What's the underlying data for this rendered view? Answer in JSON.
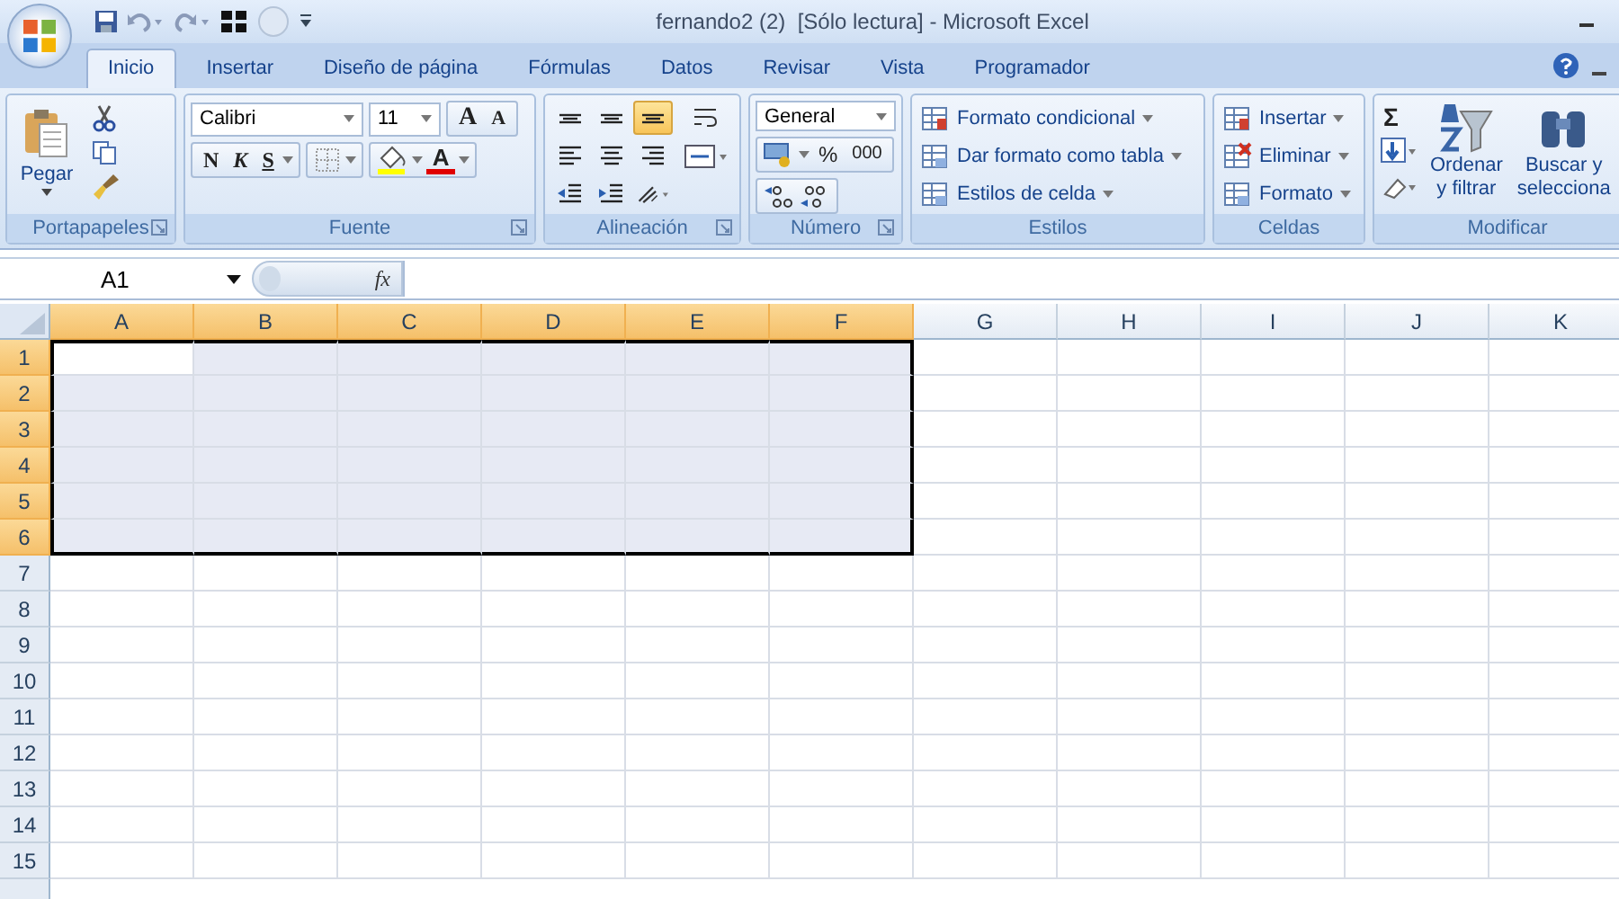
{
  "window": {
    "title": "fernando2 (2)  [Sólo lectura] - Microsoft Excel"
  },
  "tabs": [
    {
      "label": "Inicio",
      "selected": true
    },
    {
      "label": "Insertar",
      "selected": false
    },
    {
      "label": "Diseño de página",
      "selected": false
    },
    {
      "label": "Fórmulas",
      "selected": false
    },
    {
      "label": "Datos",
      "selected": false
    },
    {
      "label": "Revisar",
      "selected": false
    },
    {
      "label": "Vista",
      "selected": false
    },
    {
      "label": "Programador",
      "selected": false
    }
  ],
  "ribbon": {
    "groups": [
      {
        "kind": "clipboard",
        "label": "Portapapeles",
        "launcher": true,
        "paste": "Pegar"
      },
      {
        "kind": "font",
        "label": "Fuente",
        "launcher": true,
        "font": "Calibri",
        "size": "11",
        "grow": "A",
        "shrink": "A",
        "bold": "N",
        "italic": "K",
        "underline": "S",
        "font_color": "A"
      },
      {
        "kind": "alignment",
        "label": "Alineación",
        "launcher": true,
        "buttons": [
          {
            "kind": "top",
            "selected": false
          },
          {
            "kind": "middle",
            "selected": false
          },
          {
            "kind": "bottom",
            "selected": true
          },
          {
            "kind": "wrap",
            "selected": false
          },
          {
            "kind": "left",
            "selected": false
          },
          {
            "kind": "center",
            "selected": false
          },
          {
            "kind": "right",
            "selected": false
          },
          {
            "kind": "merge",
            "selected": false
          },
          {
            "kind": "outdent",
            "selected": false
          },
          {
            "kind": "indent",
            "selected": false
          },
          {
            "kind": "orientation",
            "selected": false
          }
        ]
      },
      {
        "kind": "number",
        "label": "Número",
        "launcher": true,
        "format": "General",
        "percent": "%",
        "thousands": "000"
      },
      {
        "kind": "styles",
        "label": "Estilos",
        "launcher": false,
        "items": [
          "Formato condicional",
          "Dar formato como tabla",
          "Estilos de celda"
        ]
      },
      {
        "kind": "cells",
        "label": "Celdas",
        "launcher": false,
        "items": [
          "Insertar",
          "Eliminar",
          "Formato"
        ]
      },
      {
        "kind": "editing",
        "label": "Modificar",
        "launcher": false,
        "sum": "Σ",
        "sort": [
          "Ordenar",
          "y filtrar"
        ],
        "find": [
          "Buscar y",
          "selecciona"
        ]
      }
    ]
  },
  "formula_bar": {
    "name_box": "A1",
    "fx": "fx"
  },
  "sheet": {
    "columns": [
      {
        "label": "A",
        "selected": true,
        "active": true
      },
      {
        "label": "B",
        "selected": true,
        "active": false
      },
      {
        "label": "C",
        "selected": true,
        "active": false
      },
      {
        "label": "D",
        "selected": true,
        "active": false
      },
      {
        "label": "E",
        "selected": true,
        "active": false
      },
      {
        "label": "F",
        "selected": true,
        "active": false
      },
      {
        "label": "G",
        "selected": false,
        "active": false
      },
      {
        "label": "H",
        "selected": false,
        "active": false
      },
      {
        "label": "I",
        "selected": false,
        "active": false
      },
      {
        "label": "J",
        "selected": false,
        "active": false
      },
      {
        "label": "K",
        "selected": false,
        "active": false
      }
    ],
    "rows": [
      {
        "label": "1",
        "selected": true,
        "active": true
      },
      {
        "label": "2",
        "selected": true,
        "active": false
      },
      {
        "label": "3",
        "selected": true,
        "active": false
      },
      {
        "label": "4",
        "selected": true,
        "active": false
      },
      {
        "label": "5",
        "selected": true,
        "active": false
      },
      {
        "label": "6",
        "selected": true,
        "active": false
      },
      {
        "label": "7",
        "selected": false,
        "active": false
      },
      {
        "label": "8",
        "selected": false,
        "active": false
      },
      {
        "label": "9",
        "selected": false,
        "active": false
      },
      {
        "label": "10",
        "selected": false,
        "active": false
      },
      {
        "label": "11",
        "selected": false,
        "active": false
      },
      {
        "label": "12",
        "selected": false,
        "active": false
      },
      {
        "label": "13",
        "selected": false,
        "active": false
      },
      {
        "label": "14",
        "selected": false,
        "active": false
      },
      {
        "label": "15",
        "selected": false,
        "active": false
      }
    ]
  }
}
